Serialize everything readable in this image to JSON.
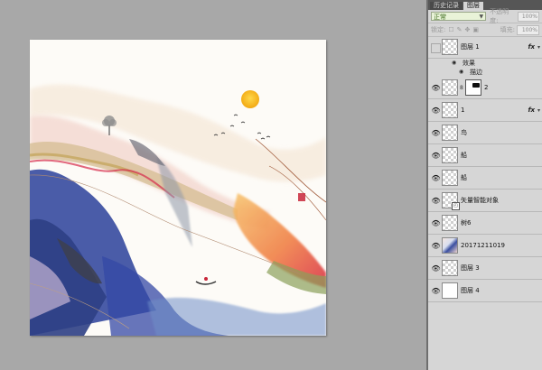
{
  "panel": {
    "tabs": [
      "历史记录",
      "图层"
    ],
    "active_tab_index": 1,
    "blend_mode": "正常",
    "opacity_label": "不透明度:",
    "opacity_value": "100%",
    "lock_label": "锁定:",
    "fill_label": "填充:",
    "fill_value": "100%"
  },
  "layers": [
    {
      "name": "图层 1",
      "visible": false,
      "thumb": "checker",
      "fx": "fx"
    },
    {
      "name": "2",
      "visible": true,
      "thumb": "checker",
      "mask": true
    },
    {
      "name": "1",
      "visible": true,
      "thumb": "checker",
      "fx": "fx"
    },
    {
      "name": "鸟",
      "visible": true,
      "thumb": "checker"
    },
    {
      "name": "船",
      "visible": true,
      "thumb": "checker"
    },
    {
      "name": "船",
      "visible": true,
      "thumb": "checker"
    },
    {
      "name": "矢量智能对象",
      "visible": true,
      "thumb": "checker",
      "smart": true
    },
    {
      "name": "树6",
      "visible": true,
      "thumb": "checker"
    },
    {
      "name": "20171211019",
      "visible": true,
      "thumb": "image"
    },
    {
      "name": "图层 3",
      "visible": true,
      "thumb": "checker"
    },
    {
      "name": "图层 4",
      "visible": true,
      "thumb": "white"
    }
  ],
  "effects": {
    "label": "效果",
    "items": [
      "描边"
    ]
  },
  "colors": {
    "sun": "#f6b41e",
    "ink_blue": "#2a3f9a",
    "crimson": "#d3243f",
    "paper": "#fdfbf7"
  }
}
